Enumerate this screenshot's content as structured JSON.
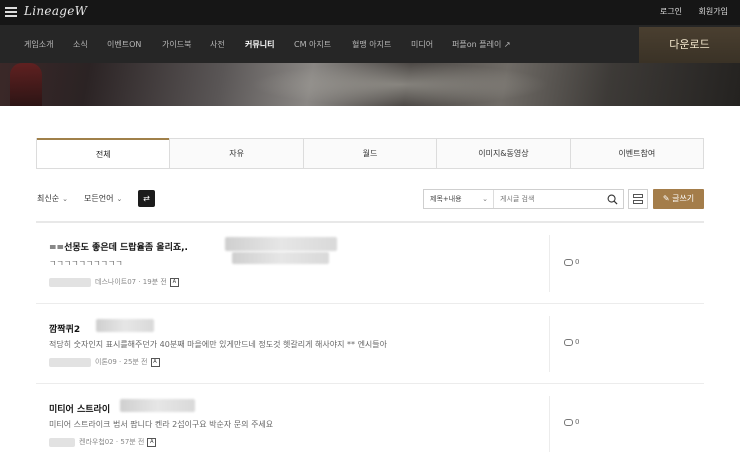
{
  "header": {
    "logo": "LineageW",
    "login": "로그인",
    "signup": "회원가입"
  },
  "nav": {
    "items": [
      "게임소개",
      "소식",
      "이벤트ON",
      "가이드북",
      "사전",
      "커뮤니티",
      "CM 아지트",
      "혈맹 아지트",
      "미디어",
      "퍼플on 플레이 ↗"
    ],
    "active": "커뮤니티",
    "download": "다운로드"
  },
  "tabs": [
    "전체",
    "자유",
    "월드",
    "이미지&동영상",
    "이벤트참여"
  ],
  "controls": {
    "sort": "최신순",
    "language": "모든언어",
    "search_scope": "제목+내용",
    "search_placeholder": "게시글 검색",
    "write": "글쓰기"
  },
  "posts": [
    {
      "title": "==선몽도 좋은데 드랍율좀 올리죠,.",
      "body": "ㄱㄱㄱㄱㄱㄱㄱㄱㄱㄱ",
      "author": "데스나이트07",
      "time": "19분 전",
      "comments": "0"
    },
    {
      "title": "깜짝퀴2",
      "body": "적당히 숫자인지 표시를해주던가 40분째 마을에만 있게만드네 정도것 헷갈리게 해사야지 ** 엔시들아",
      "author": "이톤09",
      "time": "25분 전",
      "comments": "0"
    },
    {
      "title": "미티어 스트라이",
      "body": "미티어 스트라이크 법서 팝니다 켄라 2섭이구요 박순자 문의 주세요",
      "author": "켄라우첩02",
      "time": "57분 전",
      "comments": "0"
    }
  ],
  "colors": {
    "accent": "#a47d4a",
    "topbar": "#161616",
    "nav": "#262626"
  }
}
